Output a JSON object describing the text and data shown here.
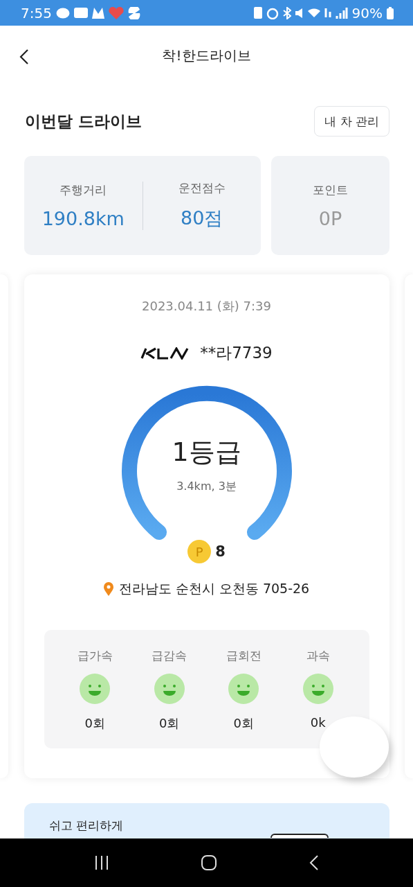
{
  "status_bar": {
    "time": "7:55",
    "battery": "90%"
  },
  "header": {
    "title": "착!한드라이브"
  },
  "section": {
    "title": "이번달 드라이브",
    "button": "내 차 관리"
  },
  "stats": [
    {
      "label": "주행거리",
      "value": "190.8km",
      "active": true
    },
    {
      "label": "운전점수",
      "value": "80점",
      "active": true
    },
    {
      "label": "포인트",
      "value": "0P",
      "active": false
    }
  ],
  "trip": {
    "datetime": "2023.04.11 (화) 7:39",
    "plate": "**라7739",
    "grade": "1등급",
    "summary": "3.4km, 3분",
    "point_badge": "P",
    "points": "8",
    "location": "전라남도 순천시 오천동 705-26",
    "behaviors": [
      {
        "label": "급가속",
        "count": "0회"
      },
      {
        "label": "급감속",
        "count": "0회"
      },
      {
        "label": "급회전",
        "count": "0회"
      },
      {
        "label": "과속",
        "count": "0k"
      }
    ]
  },
  "banner": {
    "text": "쉬고 편리하게"
  }
}
